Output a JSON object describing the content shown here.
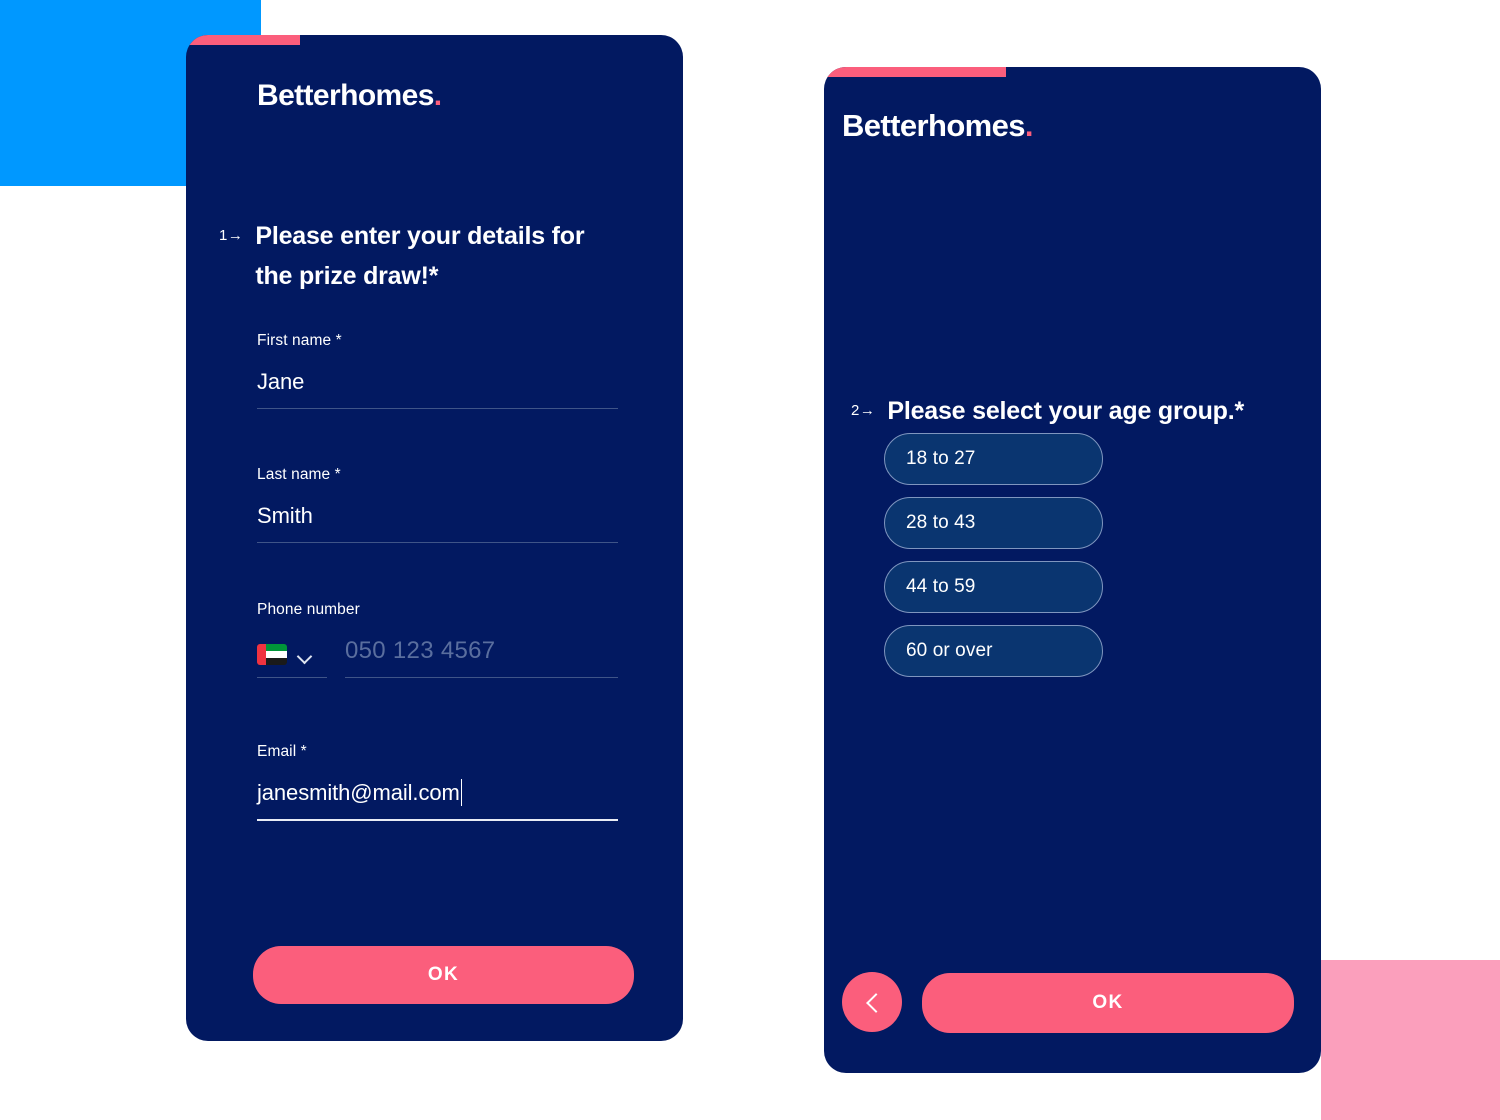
{
  "brand": {
    "name": "Betterhomes",
    "dot": ".",
    "accent_color": "#FB5E7C"
  },
  "theme": {
    "card_bg": "#021961",
    "accent_pink": "#FB5E7C",
    "chip_bg": "#0A3570",
    "chip_border": "#7F96BF",
    "deco_blue": "#0098FF",
    "deco_pink": "#FB9FBC",
    "page_bg": "#FFFFFF"
  },
  "card_details": {
    "step_number": "1",
    "step_arrow": "→",
    "question": "Please enter your details for the prize draw!*",
    "fields": {
      "first_name": {
        "label": "First name *",
        "value": "Jane"
      },
      "last_name": {
        "label": "Last name *",
        "value": "Smith"
      },
      "phone": {
        "label": "Phone number",
        "country_flag": "uae-flag-icon",
        "placeholder": "050 123 4567",
        "value": ""
      },
      "email": {
        "label": "Email *",
        "value": "janesmith@mail.com"
      }
    },
    "ok_label": "OK"
  },
  "card_age": {
    "step_number": "2",
    "step_arrow": "→",
    "question": "Please select your age group.*",
    "options": [
      {
        "label": "18 to 27"
      },
      {
        "label": "28 to 43"
      },
      {
        "label": "44 to 59"
      },
      {
        "label": "60 or over"
      }
    ],
    "ok_label": "OK",
    "back_icon": "chevron-left-icon"
  }
}
